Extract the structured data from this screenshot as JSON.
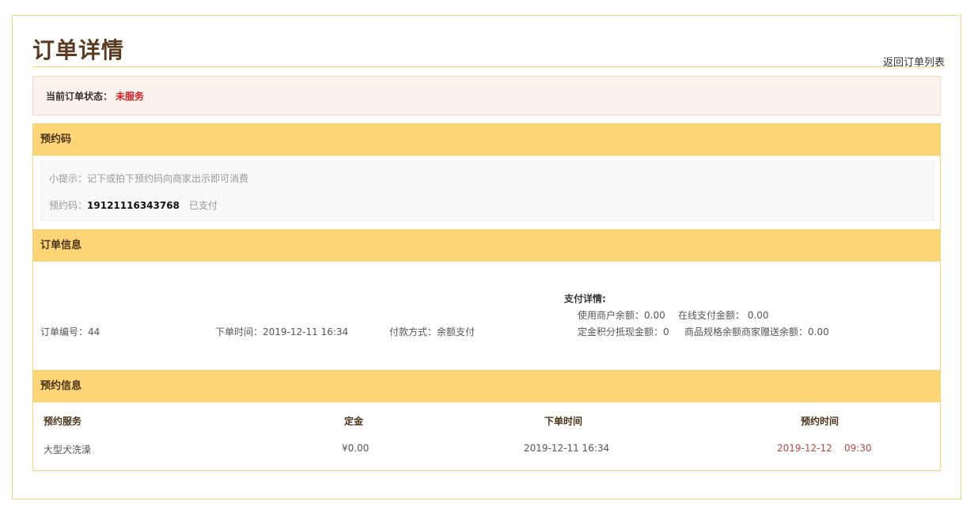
{
  "page": {
    "title": "订单详情",
    "back_link": "返回订单列表"
  },
  "status": {
    "label": "当前订单状态：",
    "value": "未服务",
    "value_color": "#d61d1d"
  },
  "reservation_code_section": {
    "heading": "预约码",
    "hint": "小提示：记下或拍下预约码向商家出示即可消费",
    "code_label": "预约码：",
    "code_value": "19121116343768",
    "paid_status": "已支付"
  },
  "order_info_section": {
    "heading": "订单信息",
    "order_no_label": "订单编号：",
    "order_no": "44",
    "order_time_label": "下单时间：",
    "order_time": "2019-12-11 16:34",
    "payment_method_label": "付款方式：",
    "payment_method": "余额支付",
    "payment_details": {
      "title": "支付详情:",
      "merchant_balance_label": "使用商户余额：",
      "merchant_balance": "0.00",
      "online_payment_label": "在线支付金额：",
      "online_payment": "0.00",
      "points_deduction_label": "定金积分抵现金额：",
      "points_deduction": "0",
      "gift_balance_label": "商品规格余额商家赠送余额：",
      "gift_balance": "0.00"
    }
  },
  "reservation_info_section": {
    "heading": "预约信息",
    "columns": [
      "预约服务",
      "定金",
      "下单时间",
      "预约时间"
    ],
    "row": {
      "service": "大型犬洗澡",
      "deposit": "¥0.00",
      "order_time": "2019-12-11 16:34",
      "appointment_date": "2019-12-12",
      "appointment_time": "09:30"
    }
  },
  "colors": {
    "accent": "#fed576",
    "border": "#f3d57c",
    "title": "#5a3b1f"
  }
}
